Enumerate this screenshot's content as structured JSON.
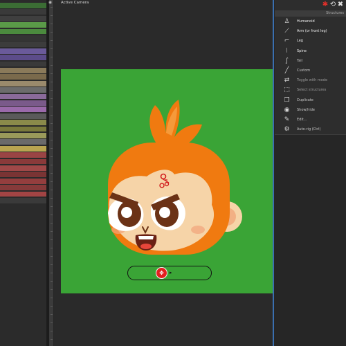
{
  "viewport": {
    "title": "Active Camera"
  },
  "panel": {
    "header": "Structures",
    "toolbar": [
      {
        "name": "rig-icon",
        "glyph": "✱",
        "color": "#e0302a"
      },
      {
        "name": "transfer-icon",
        "glyph": "⟲",
        "color": "#dddddd"
      },
      {
        "name": "delete-icon",
        "glyph": "✖",
        "color": "#dddddd"
      }
    ],
    "items": [
      {
        "name": "humanoid",
        "label": "Humanoid",
        "icon": "humanoid-icon",
        "glyph": "♙"
      },
      {
        "name": "arm",
        "label": "Arm (or front leg)",
        "icon": "arm-icon",
        "glyph": "⟋"
      },
      {
        "name": "leg",
        "label": "Leg",
        "icon": "leg-icon",
        "glyph": "⌐"
      },
      {
        "name": "spine",
        "label": "Spine",
        "icon": "spine-icon",
        "glyph": "⦚"
      },
      {
        "name": "tail",
        "label": "Tail",
        "icon": "tail-icon",
        "glyph": "∫"
      },
      {
        "name": "custom",
        "label": "Custom",
        "icon": "custom-icon",
        "glyph": "╱"
      },
      {
        "name": "toggle-with-mode",
        "label": "Toggle with mode",
        "icon": "toggle-icon",
        "glyph": "⇄"
      },
      {
        "name": "select-structures",
        "label": "Select structures",
        "icon": "select-icon",
        "glyph": "⬚"
      },
      {
        "name": "duplicate",
        "label": "Duplicate",
        "icon": "duplicate-icon",
        "glyph": "❐"
      },
      {
        "name": "show-hide",
        "label": "Show/hide",
        "icon": "eye-icon",
        "glyph": "◉"
      },
      {
        "name": "edit",
        "label": "Edit...",
        "icon": "wrench-icon",
        "glyph": "✎"
      },
      {
        "name": "auto-rig",
        "label": "Auto-rig (Ctrl)",
        "icon": "autorig-icon",
        "glyph": "⚙"
      }
    ]
  },
  "timeline": {
    "rows": [
      "#3b6d34",
      "#3a3a3a",
      "#3f3f3f",
      "#5a9a48",
      "#4b8a3e",
      "#343434",
      "#3c3c3c",
      "#6a5a9a",
      "#5c4c8a",
      "#3a3a3a",
      "#8a7a5a",
      "#7a6a4c",
      "#9a8a6c",
      "#6c6c6c",
      "#8a6a9a",
      "#7a5a8a",
      "#9a6aaa",
      "#5a5a5a",
      "#8a8a4a",
      "#7a7a3c",
      "#9a9a5a",
      "#6a6a6a",
      "#b8a450",
      "#9a4444",
      "#8a3a3a",
      "#a04848",
      "#7a3434",
      "#943e3e",
      "#863a3a",
      "#a24444",
      "#3a3a3a"
    ]
  },
  "slider": {
    "knob_glyph": "✥",
    "arrow_glyph": "▸"
  },
  "colors": {
    "stage": "#3aa436",
    "accent": "#e41f1f",
    "orange": "#f07a10",
    "skin": "#f6d4a8"
  }
}
